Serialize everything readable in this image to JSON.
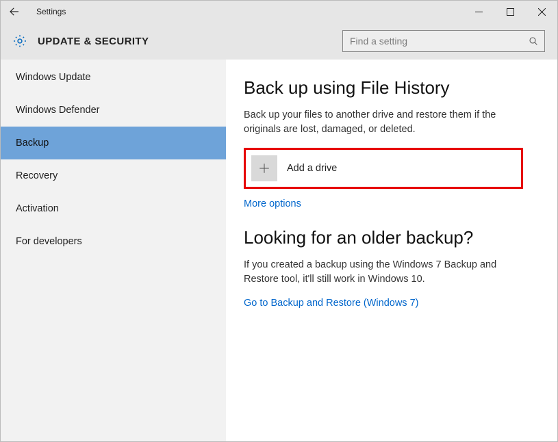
{
  "window": {
    "title": "Settings"
  },
  "header": {
    "section": "UPDATE & SECURITY",
    "search_placeholder": "Find a setting"
  },
  "sidebar": {
    "items": [
      {
        "label": "Windows Update",
        "selected": false
      },
      {
        "label": "Windows Defender",
        "selected": false
      },
      {
        "label": "Backup",
        "selected": true
      },
      {
        "label": "Recovery",
        "selected": false
      },
      {
        "label": "Activation",
        "selected": false
      },
      {
        "label": "For developers",
        "selected": false
      }
    ]
  },
  "main": {
    "heading1": "Back up using File History",
    "desc1": "Back up your files to another drive and restore them if the originals are lost, damaged, or deleted.",
    "add_drive_label": "Add a drive",
    "more_options": "More options",
    "heading2": "Looking for an older backup?",
    "desc2": "If you created a backup using the Windows 7 Backup and Restore tool, it'll still work in Windows 10.",
    "link2": "Go to Backup and Restore (Windows 7)"
  }
}
